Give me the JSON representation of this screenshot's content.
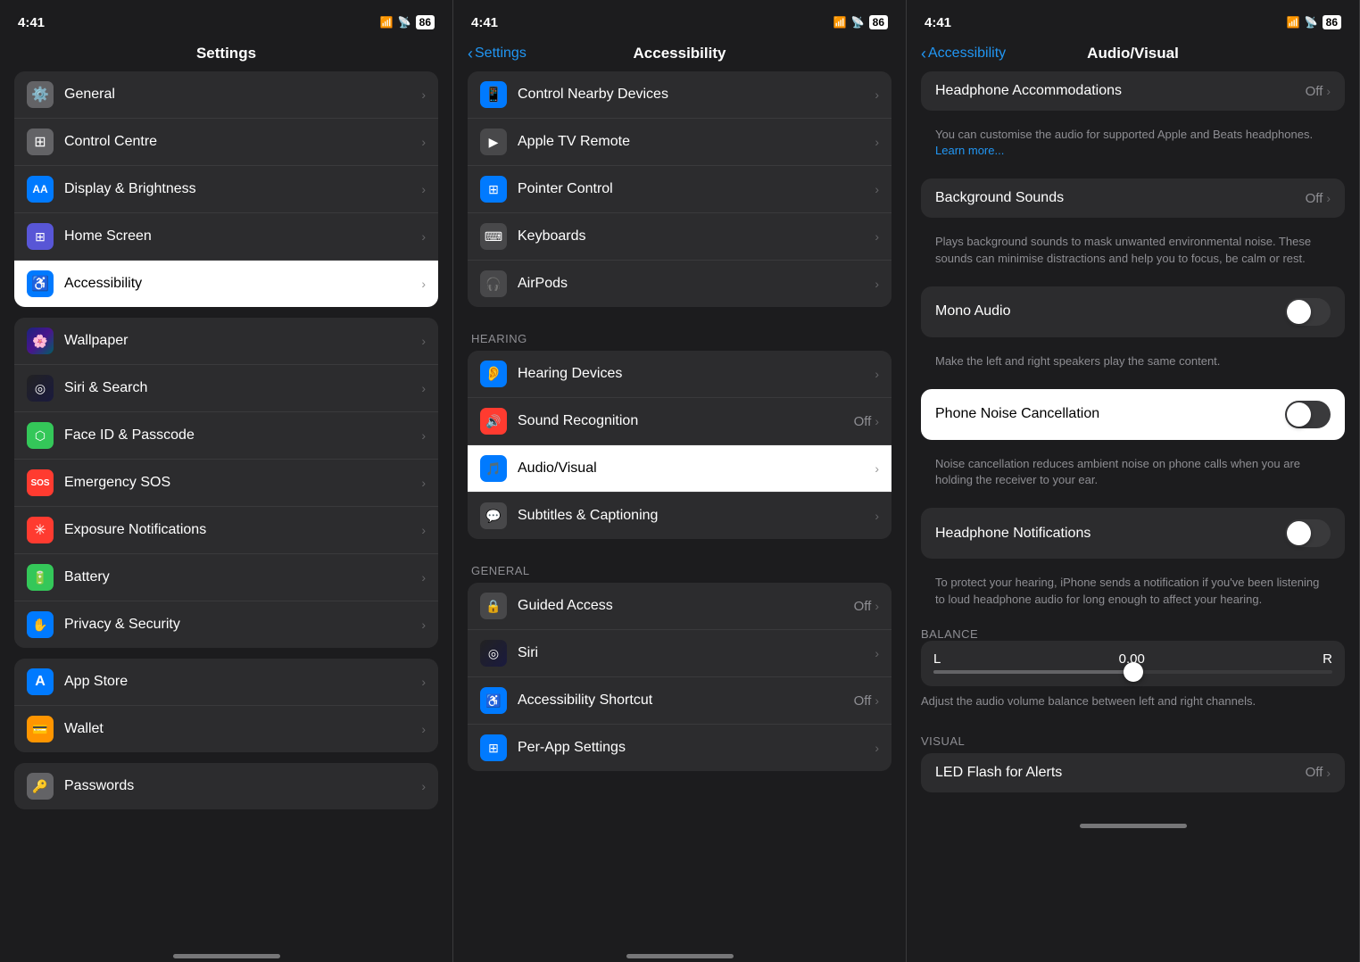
{
  "panels": [
    {
      "id": "settings",
      "statusTime": "4:41",
      "navTitle": "Settings",
      "navBack": null,
      "sections": [
        {
          "label": null,
          "items": [
            {
              "id": "general",
              "icon": "⚙️",
              "iconBg": "bg-gray",
              "label": "General",
              "value": null
            },
            {
              "id": "control-centre",
              "icon": "⊞",
              "iconBg": "bg-gray",
              "label": "Control Centre",
              "value": null
            },
            {
              "id": "display-brightness",
              "icon": "𝐀𝐀",
              "iconBg": "bg-blue",
              "label": "Display & Brightness",
              "value": null
            },
            {
              "id": "home-screen",
              "icon": "⊞",
              "iconBg": "bg-indigo",
              "label": "Home Screen",
              "value": null
            },
            {
              "id": "accessibility",
              "icon": "♿",
              "iconBg": "bg-blue",
              "label": "Accessibility",
              "value": null,
              "selected": true
            }
          ]
        },
        {
          "label": null,
          "items": [
            {
              "id": "wallpaper",
              "icon": "🌸",
              "iconBg": "bg-wallpaper",
              "label": "Wallpaper",
              "value": null
            },
            {
              "id": "siri-search",
              "icon": "◎",
              "iconBg": "bg-dark-gray",
              "label": "Siri & Search",
              "value": null
            },
            {
              "id": "face-id",
              "icon": "⬡",
              "iconBg": "bg-green",
              "label": "Face ID & Passcode",
              "value": null
            },
            {
              "id": "emergency-sos",
              "icon": "SOS",
              "iconBg": "bg-red",
              "label": "Emergency SOS",
              "value": null
            },
            {
              "id": "exposure",
              "icon": "✳",
              "iconBg": "bg-red",
              "label": "Exposure Notifications",
              "value": null
            },
            {
              "id": "battery",
              "icon": "🔋",
              "iconBg": "bg-green",
              "label": "Battery",
              "value": null
            },
            {
              "id": "privacy",
              "icon": "✋",
              "iconBg": "bg-blue",
              "label": "Privacy & Security",
              "value": null
            }
          ]
        },
        {
          "label": null,
          "items": [
            {
              "id": "app-store",
              "icon": "A",
              "iconBg": "bg-blue",
              "label": "App Store",
              "value": null
            },
            {
              "id": "wallet",
              "icon": "💳",
              "iconBg": "bg-orange",
              "label": "Wallet",
              "value": null
            }
          ]
        },
        {
          "label": null,
          "items": [
            {
              "id": "passwords",
              "icon": "🔑",
              "iconBg": "bg-gray",
              "label": "Passwords",
              "value": null
            }
          ]
        }
      ]
    },
    {
      "id": "accessibility",
      "statusTime": "4:41",
      "navTitle": "Accessibility",
      "navBack": "Settings",
      "sections": [
        {
          "label": null,
          "items": [
            {
              "id": "control-nearby",
              "icon": "📱",
              "iconBg": "bg-blue",
              "label": "Control Nearby Devices",
              "value": null
            },
            {
              "id": "apple-tv",
              "icon": "▶",
              "iconBg": "bg-gray",
              "label": "Apple TV Remote",
              "value": null
            },
            {
              "id": "pointer-control",
              "icon": "⊞",
              "iconBg": "bg-blue",
              "label": "Pointer Control",
              "value": null
            },
            {
              "id": "keyboards",
              "icon": "⌨",
              "iconBg": "bg-gray",
              "label": "Keyboards",
              "value": null
            },
            {
              "id": "airpods",
              "icon": "🎧",
              "iconBg": "bg-gray",
              "label": "AirPods",
              "value": null
            }
          ]
        },
        {
          "label": "HEARING",
          "items": [
            {
              "id": "hearing-devices",
              "icon": "👂",
              "iconBg": "bg-blue",
              "label": "Hearing Devices",
              "value": null
            },
            {
              "id": "sound-recognition",
              "icon": "🔊",
              "iconBg": "bg-red",
              "label": "Sound Recognition",
              "value": "Off"
            },
            {
              "id": "audio-visual",
              "icon": "🎵",
              "iconBg": "bg-blue",
              "label": "Audio/Visual",
              "value": null,
              "selected": true
            },
            {
              "id": "subtitles",
              "icon": "💬",
              "iconBg": "bg-gray",
              "label": "Subtitles & Captioning",
              "value": null
            }
          ]
        },
        {
          "label": "GENERAL",
          "items": [
            {
              "id": "guided-access",
              "icon": "🔒",
              "iconBg": "bg-gray",
              "label": "Guided Access",
              "value": "Off"
            },
            {
              "id": "siri",
              "icon": "◎",
              "iconBg": "bg-siri",
              "label": "Siri",
              "value": null
            },
            {
              "id": "accessibility-shortcut",
              "icon": "♿",
              "iconBg": "bg-blue",
              "label": "Accessibility Shortcut",
              "value": "Off"
            },
            {
              "id": "per-app",
              "icon": "⊞",
              "iconBg": "bg-blue",
              "label": "Per-App Settings",
              "value": null
            }
          ]
        }
      ]
    },
    {
      "id": "audio-visual",
      "statusTime": "4:41",
      "navTitle": "Audio/Visual",
      "navBack": "Accessibility",
      "items": [
        {
          "id": "headphone-accommodations",
          "label": "Headphone Accommodations",
          "value": "Off",
          "description": "You can customise the audio for supported Apple and Beats headphones.",
          "learnMore": "Learn more..."
        },
        {
          "id": "background-sounds",
          "label": "Background Sounds",
          "value": "Off",
          "description": "Plays background sounds to mask unwanted environmental noise. These sounds can minimise distractions and help you to focus, be calm or rest."
        },
        {
          "id": "mono-audio",
          "label": "Mono Audio",
          "toggle": false,
          "description": "Make the left and right speakers play the same content."
        },
        {
          "id": "phone-noise-cancellation",
          "label": "Phone Noise Cancellation",
          "toggle": false,
          "selected": true,
          "description": "Noise cancellation reduces ambient noise on phone calls when you are holding the receiver to your ear."
        },
        {
          "id": "headphone-notifications",
          "label": "Headphone Notifications",
          "toggle": false,
          "description": "To protect your hearing, iPhone sends a notification if you've been listening to loud headphone audio for long enough to affect your hearing."
        }
      ],
      "balance": {
        "sectionLabel": "BALANCE",
        "l": "L",
        "r": "R",
        "value": "0.00",
        "description": "Adjust the audio volume balance between left and right channels."
      },
      "visualSection": {
        "label": "VISUAL",
        "ledLabel": "LED Flash for Alerts",
        "ledValue": "Off"
      }
    }
  ]
}
